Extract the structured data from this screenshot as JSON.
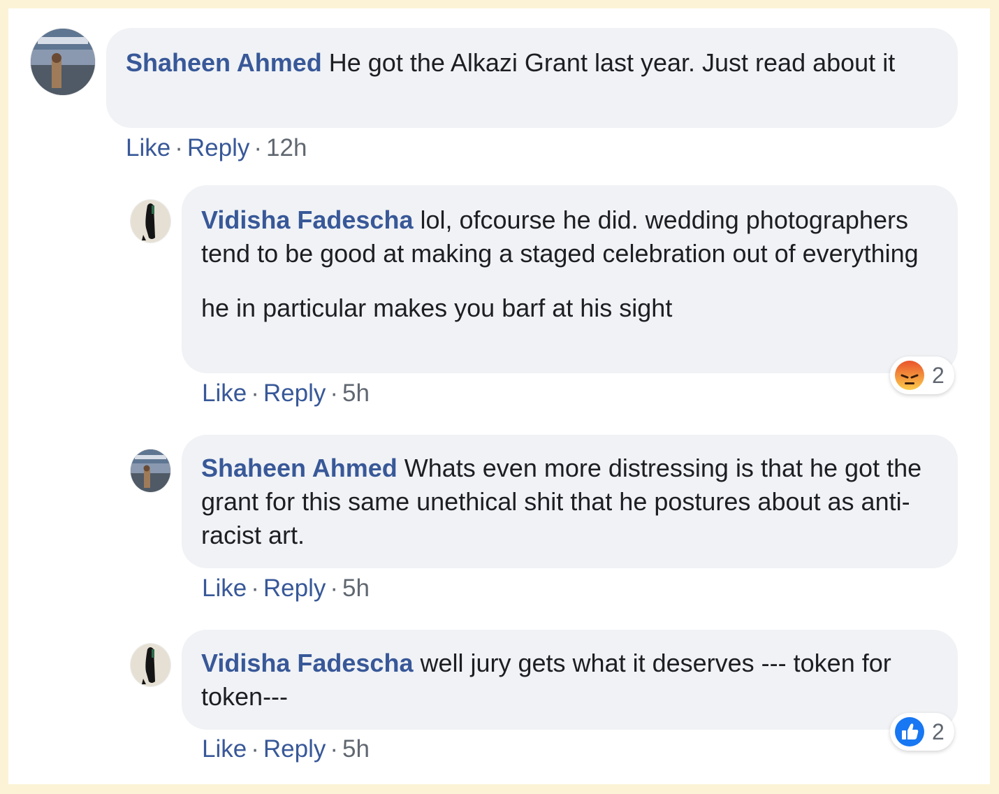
{
  "comments": [
    {
      "author": "Shaheen Ahmed",
      "text": "He got the Alkazi Grant last year. Just read about it",
      "like_label": "Like",
      "reply_label": "Reply",
      "time": "12h"
    },
    {
      "author": "Vidisha Fadescha",
      "text": "lol, ofcourse he did. wedding photographers tend to be good at making a staged celebration out of everything",
      "text2": "he in particular makes you barf at his sight",
      "like_label": "Like",
      "reply_label": "Reply",
      "time": "5h",
      "reaction": {
        "icon": "angry-reaction-icon",
        "count": "2"
      }
    },
    {
      "author": "Shaheen Ahmed",
      "text": "Whats even more distressing is that he got the grant for this same unethical shit that he postures about as anti-racist art.",
      "like_label": "Like",
      "reply_label": "Reply",
      "time": "5h"
    },
    {
      "author": "Vidisha Fadescha",
      "text": "well jury gets what it deserves --- token for token---",
      "like_label": "Like",
      "reply_label": "Reply",
      "time": "5h",
      "reaction": {
        "icon": "like-reaction-icon",
        "count": "2"
      }
    }
  ],
  "separator": "·",
  "colors": {
    "page_border": "#fcf3d6",
    "bubble": "#f0f2f5",
    "author": "#385898",
    "meta": "#606770",
    "like_blue": "#1877f2"
  }
}
